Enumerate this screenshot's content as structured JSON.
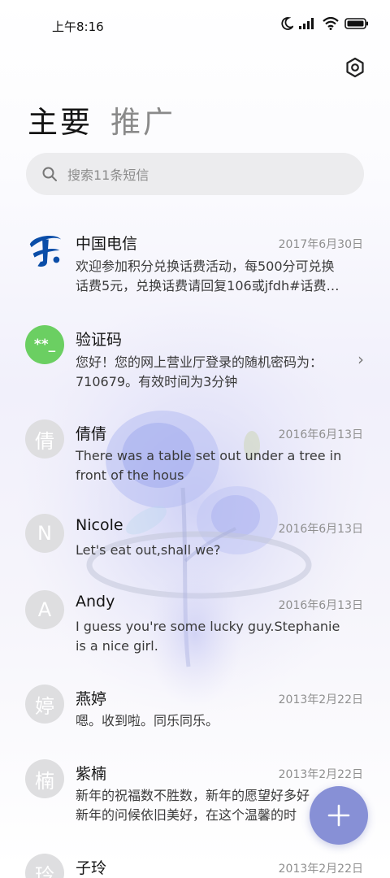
{
  "status": {
    "time": "上午8:16",
    "battery_icon": "battery-icon",
    "wifi_icon": "wifi-icon",
    "signal_icon": "signal-icon",
    "moon_icon": "moon-icon"
  },
  "tabs": {
    "primary": "主要",
    "promotions": "推广"
  },
  "search": {
    "placeholder": "搜索11条短信"
  },
  "conversations": [
    {
      "name": "中国电信",
      "date": "2017年6月30日",
      "line1": "欢迎参加积分兑换话费活动，每500分可兑换",
      "line2": "话费5元，兑换话费请回复106或jfdh#话费…",
      "avatar": "china-telecom-logo"
    },
    {
      "name": "验证码",
      "date": "",
      "line1": "您好！您的网上营业厅登录的随机密码为：",
      "line2": "710679。有效时间为3分钟",
      "avatar_text": "**_"
    },
    {
      "name": "倩倩",
      "date": "2016年6月13日",
      "line1": "There was a table set out under a tree in",
      "line2": "front of the hous",
      "avatar_text": "倩"
    },
    {
      "name": "Nicole",
      "date": "2016年6月13日",
      "line1": "Let's eat out,shall we?",
      "line2": "",
      "avatar_text": "N"
    },
    {
      "name": "Andy",
      "date": "2016年6月13日",
      "line1": "I guess you're some lucky guy.Stephanie",
      "line2": "is a nice girl.",
      "avatar_text": "A"
    },
    {
      "name": "燕婷",
      "date": "2013年2月22日",
      "line1": "嗯。收到啦。同乐同乐。",
      "line2": "",
      "avatar_text": "婷"
    },
    {
      "name": "紫楠",
      "date": "2013年2月22日",
      "line1": "新年的祝福数不胜数，新年的愿望好多好",
      "line2": "新年的问候依旧美好，在这个温馨的时",
      "avatar_text": "楠"
    },
    {
      "name": "子玲",
      "date": "2013年2月22日",
      "line1": "",
      "line2": "",
      "avatar_text": "玲"
    }
  ],
  "colors": {
    "accent": "#8790d6",
    "verification_avatar": "#6bcf62",
    "telecom_blue": "#0a4da8"
  }
}
